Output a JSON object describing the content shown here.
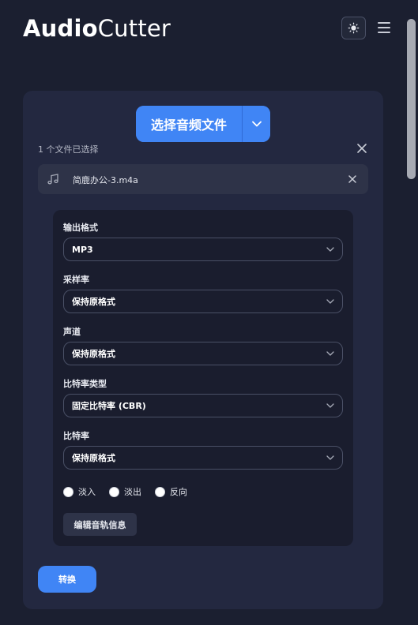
{
  "header": {
    "logo_bold": "Audio",
    "logo_light": "Cutter",
    "theme_icon": "sun-icon",
    "menu_icon": "hamburger-menu-icon"
  },
  "upload": {
    "button_label": "选择音频文件",
    "dropdown_icon": "chevron-down-icon",
    "file_count_text": "1 个文件已选择",
    "files": [
      {
        "name": "简鹿办公-3.m4a",
        "icon": "music-note-icon"
      }
    ]
  },
  "settings": {
    "output_format": {
      "label": "输出格式",
      "value": "MP3"
    },
    "sample_rate": {
      "label": "采样率",
      "value": "保持原格式"
    },
    "channels": {
      "label": "声道",
      "value": "保持原格式"
    },
    "bitrate_type": {
      "label": "比特率类型",
      "value": "固定比特率 (CBR)"
    },
    "bitrate": {
      "label": "比特率",
      "value": "保持原格式"
    },
    "effects": [
      {
        "label": "淡入",
        "checked": false
      },
      {
        "label": "淡出",
        "checked": false
      },
      {
        "label": "反向",
        "checked": false
      }
    ],
    "edit_tracks_label": "编辑音轨信息"
  },
  "convert_label": "转换",
  "colors": {
    "background": "#1b1f30",
    "card": "#232840",
    "panel": "#1a1d2e",
    "accent": "#4085f5"
  }
}
